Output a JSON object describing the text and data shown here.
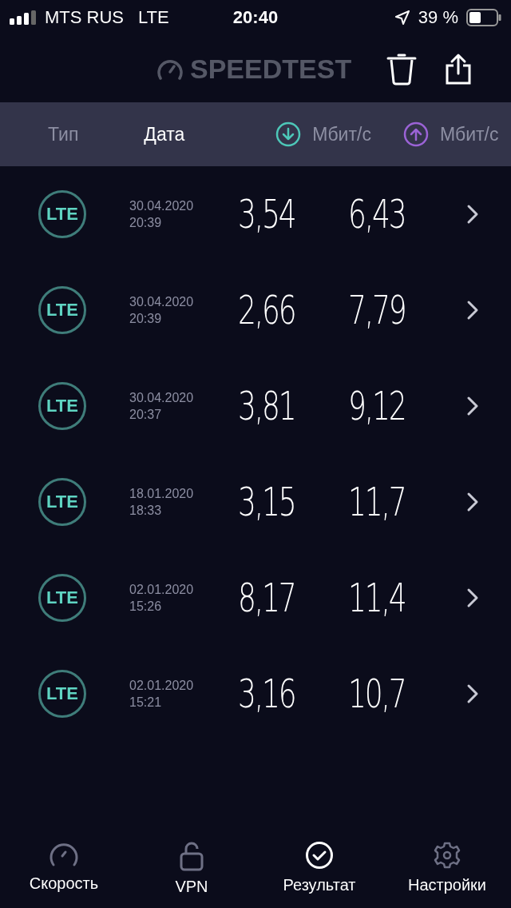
{
  "status_bar": {
    "carrier": "MTS RUS",
    "network": "LTE",
    "time": "20:40",
    "battery": "39 %"
  },
  "header": {
    "logo": "SPEEDTEST"
  },
  "sort_bar": {
    "columns": [
      {
        "kind": "text",
        "label": "Тип",
        "selected": false
      },
      {
        "kind": "text",
        "label": "Дата",
        "selected": true
      },
      {
        "kind": "download",
        "label": "Мбит/с",
        "selected": false
      },
      {
        "kind": "upload",
        "label": "Мбит/с",
        "selected": false
      }
    ]
  },
  "results": [
    {
      "type": "LTE",
      "date": "30.04.2020",
      "time": "20:39",
      "download": "3,54",
      "upload": "6,43"
    },
    {
      "type": "LTE",
      "date": "30.04.2020",
      "time": "20:39",
      "download": "2,66",
      "upload": "7,79"
    },
    {
      "type": "LTE",
      "date": "30.04.2020",
      "time": "20:37",
      "download": "3,81",
      "upload": "9,12"
    },
    {
      "type": "LTE",
      "date": "18.01.2020",
      "time": "18:33",
      "download": "3,15",
      "upload": "11,7"
    },
    {
      "type": "LTE",
      "date": "02.01.2020",
      "time": "15:26",
      "download": "8,17",
      "upload": "11,4"
    },
    {
      "type": "LTE",
      "date": "02.01.2020",
      "time": "15:21",
      "download": "3,16",
      "upload": "10,7"
    }
  ],
  "tab_bar": {
    "tabs": [
      {
        "kind": "speed",
        "label": "Скорость",
        "selected": false
      },
      {
        "kind": "vpn",
        "label": "VPN",
        "selected": false
      },
      {
        "kind": "results",
        "label": "Результат",
        "selected": true
      },
      {
        "kind": "settings",
        "label": "Настройки",
        "selected": false
      }
    ]
  }
}
